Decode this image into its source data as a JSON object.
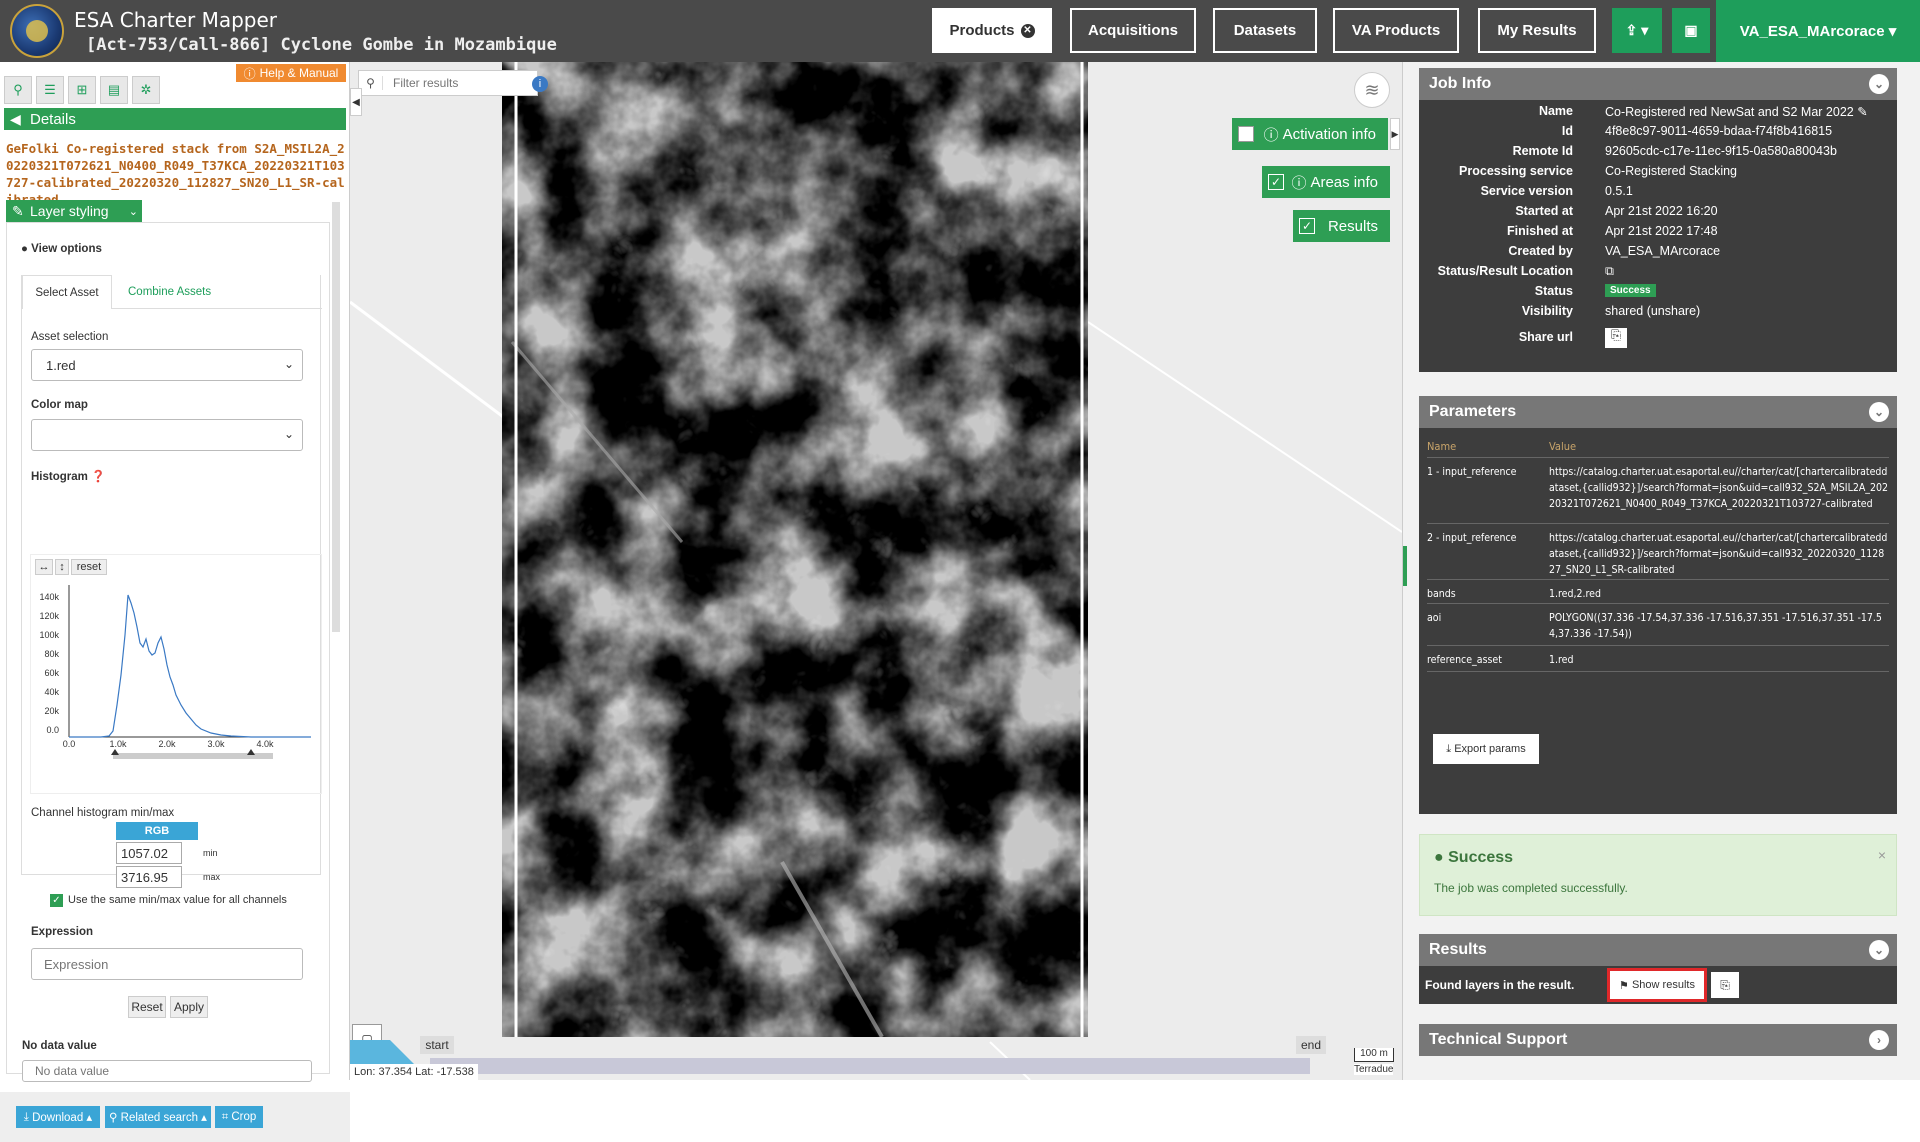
{
  "header": {
    "app_title": "ESA Charter Mapper",
    "subtitle": "[Act-753/Call-866] Cyclone Gombe in Mozambique",
    "nav": {
      "products": "Products",
      "acquisitions": "Acquisitions",
      "datasets": "Datasets",
      "va_products": "VA Products",
      "my_results": "My Results"
    },
    "user": "VA_ESA_MArcorace ▾"
  },
  "left": {
    "help": "Help & Manual",
    "details": "Details",
    "product_name": "GeFolki Co-registered stack from S2A_MSIL2A_20220321T072621_N0400_R049_T37KCA_20220321T103727-calibrated_20220320_112827_SN20_L1_SR-calibrated",
    "layer_styling": "Layer styling",
    "view_options": "View options",
    "tabs": {
      "select_asset": "Select Asset",
      "combine_assets": "Combine Assets"
    },
    "asset_selection_label": "Asset selection",
    "asset_selection_value": "1.red",
    "color_map_label": "Color map",
    "histogram_label": "Histogram",
    "histogram": {
      "reset": "reset",
      "y_ticks": [
        "140k",
        "120k",
        "100k",
        "80k",
        "60k",
        "40k",
        "20k",
        "0.0"
      ],
      "x_ticks": [
        "0.0",
        "1.0k",
        "2.0k",
        "3.0k",
        "4.0k"
      ]
    },
    "channel_minmax_label": "Channel histogram min/max",
    "rgb": "RGB",
    "min_value": "1057.02",
    "min_label": "min",
    "max_value": "3716.95",
    "max_label": "max",
    "same_minmax": "Use the same min/max value for all channels",
    "expression_label": "Expression",
    "expression_placeholder": "Expression",
    "reset_btn": "Reset",
    "apply_btn": "Apply",
    "nodata_label": "No data value",
    "nodata_placeholder": "No data value",
    "bottom": {
      "download": "Download ▴",
      "related": "Related search ▴",
      "crop": "Crop"
    }
  },
  "map": {
    "filter_placeholder": "Filter results",
    "activation_info": "Activation info",
    "areas_info": "Areas info",
    "results": "Results",
    "start": "start",
    "end": "end",
    "scale": "100 m",
    "coords": "Lon: 37.354 Lat: -17.538",
    "attribution": "Terradue"
  },
  "job_info": {
    "title": "Job Info",
    "rows": [
      {
        "k": "Name",
        "v": "Co-Registered red NewSat and S2 Mar 2022 ✎"
      },
      {
        "k": "Id",
        "v": "4f8e8c97-9011-4659-bdaa-f74f8b416815"
      },
      {
        "k": "Remote Id",
        "v": "92605cdc-c17e-11ec-9f15-0a580a80043b"
      },
      {
        "k": "Processing service",
        "v": "Co-Registered Stacking"
      },
      {
        "k": "Service version",
        "v": "0.5.1"
      },
      {
        "k": "Started at",
        "v": "Apr 21st 2022 16:20"
      },
      {
        "k": "Finished at",
        "v": "Apr 21st 2022 17:48"
      },
      {
        "k": "Created by",
        "v": "VA_ESA_MArcorace"
      },
      {
        "k": "Status/Result Location",
        "v": "⧉"
      },
      {
        "k": "Status",
        "v": "Success"
      },
      {
        "k": "Visibility",
        "v": "shared (unshare)"
      },
      {
        "k": "Share url",
        "v": "⎘"
      }
    ]
  },
  "parameters": {
    "title": "Parameters",
    "col_name": "Name",
    "col_value": "Value",
    "rows": [
      {
        "name": "1 - input_reference",
        "value": "https://catalog.charter.uat.esaportal.eu//charter/cat/[chartercalibrateddataset,{callid932}]/search?format=json&uid=call932_S2A_MSIL2A_20220321T072621_N0400_R049_T37KCA_20220321T103727-calibrated"
      },
      {
        "name": "2 - input_reference",
        "value": "https://catalog.charter.uat.esaportal.eu//charter/cat/[chartercalibrateddataset,{callid932}]/search?format=json&uid=call932_20220320_112827_SN20_L1_SR-calibrated"
      },
      {
        "name": "bands",
        "value": "1.red,2.red"
      },
      {
        "name": "aoi",
        "value": "POLYGON((37.336 -17.54,37.336 -17.516,37.351 -17.516,37.351 -17.54,37.336 -17.54))"
      },
      {
        "name": "reference_asset",
        "value": "1.red"
      }
    ],
    "export": "Export params"
  },
  "success": {
    "title": "Success",
    "message": "The job was completed successfully."
  },
  "results": {
    "title": "Results",
    "found": "Found layers in the result.",
    "show": "Show results"
  },
  "support": {
    "title": "Technical Support"
  },
  "colors": {
    "green": "#2e9e54",
    "orange": "#f08a30",
    "blue": "#3aa5d6",
    "highlight": "#e0282a"
  }
}
